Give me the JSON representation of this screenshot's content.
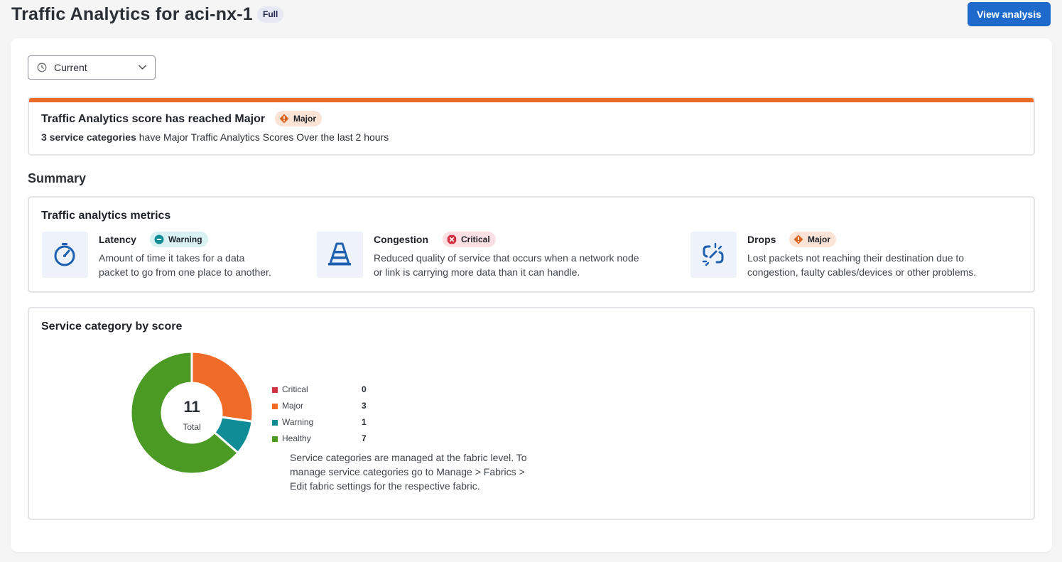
{
  "header": {
    "title": "Traffic Analytics for aci-nx-1",
    "badge": "Full",
    "view_button": "View analysis"
  },
  "time_select": {
    "value": "Current",
    "icon": "clock-icon"
  },
  "alert": {
    "title": "Traffic Analytics score has reached Major",
    "badge": "Major",
    "desc_bold": "3 service categories",
    "desc_rest": " have Major Traffic Analytics Scores Over the last 2 hours",
    "color": "#ea6a2a"
  },
  "summary": {
    "title": "Summary",
    "metrics_title": "Traffic analytics metrics",
    "metrics": [
      {
        "name": "Latency",
        "status": "Warning",
        "icon": "stopwatch-icon",
        "desc_line1": "Amount of time it takes for a data",
        "desc_line2": "packet to go from one place to another."
      },
      {
        "name": "Congestion",
        "status": "Critical",
        "icon": "traffic-cone-icon",
        "desc_line1": "Reduced quality of service that occurs when a network node",
        "desc_line2": "or link is carrying more data than it can handle."
      },
      {
        "name": "Drops",
        "status": "Major",
        "icon": "broken-link-icon",
        "desc_line1": "Lost packets not reaching their destination due to",
        "desc_line2": "congestion, faulty cables/devices or other problems."
      }
    ]
  },
  "service_panel": {
    "title": "Service category by score",
    "total": "11",
    "total_label": "Total",
    "note": "Service categories are managed at the fabric level. To manage service categories go to Manage > Fabrics > Edit fabric settings for the respective fabric."
  },
  "colors": {
    "critical": "#d0333f",
    "major": "#f06b27",
    "warning": "#0f8c96",
    "healthy": "#4a9a23",
    "accent": "#1d69cc"
  },
  "chart_data": {
    "type": "pie",
    "categories": [
      "Critical",
      "Major",
      "Warning",
      "Healthy"
    ],
    "values": [
      0,
      3,
      1,
      7
    ],
    "series": [
      {
        "values": [
          0,
          3,
          1,
          7
        ]
      }
    ],
    "title": "Service category by score",
    "total": 11
  }
}
